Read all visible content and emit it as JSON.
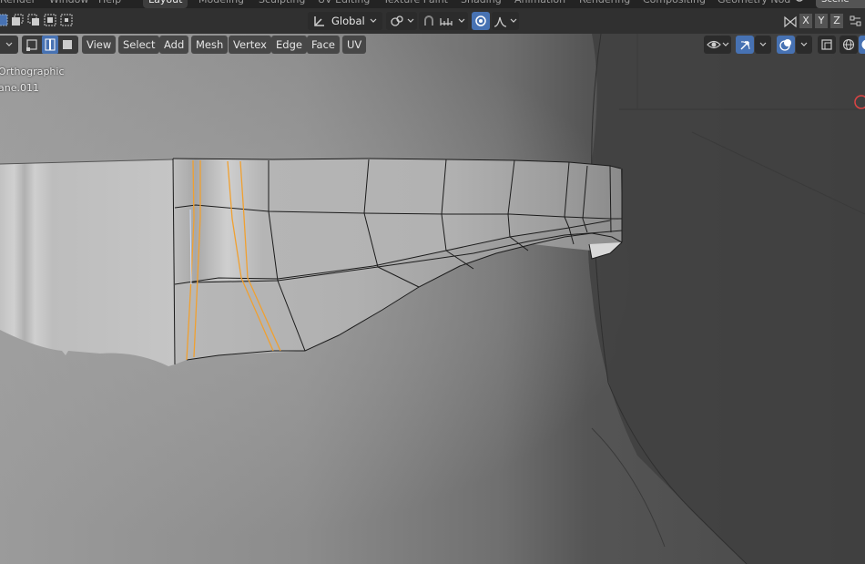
{
  "topbar": {
    "menus": [
      "Render",
      "Window",
      "Help"
    ],
    "tabs": [
      {
        "label": "Layout",
        "active": true
      },
      {
        "label": "Modeling",
        "active": false
      },
      {
        "label": "Sculpting",
        "active": false
      },
      {
        "label": "UV Editing",
        "active": false
      },
      {
        "label": "Texture Paint",
        "active": false
      },
      {
        "label": "Shading",
        "active": false
      },
      {
        "label": "Animation",
        "active": false
      },
      {
        "label": "Rendering",
        "active": false
      },
      {
        "label": "Compositing",
        "active": false
      },
      {
        "label": "Geometry Nod",
        "active": false
      }
    ],
    "scene_label": "Scene"
  },
  "header1": {
    "transform_orientation": "Global",
    "mirror_axes": [
      "X",
      "Y",
      "Z"
    ]
  },
  "header2": {
    "menus": [
      "View",
      "Select",
      "Add",
      "Mesh",
      "Vertex",
      "Edge",
      "Face",
      "UV"
    ]
  },
  "viewport": {
    "view_name": "Orthographic",
    "object_name": "ane.011"
  },
  "colors": {
    "accent_blue": "#4772b3",
    "selected_edge": "#f0a030",
    "mesh_wire": "#1a1a1a"
  }
}
